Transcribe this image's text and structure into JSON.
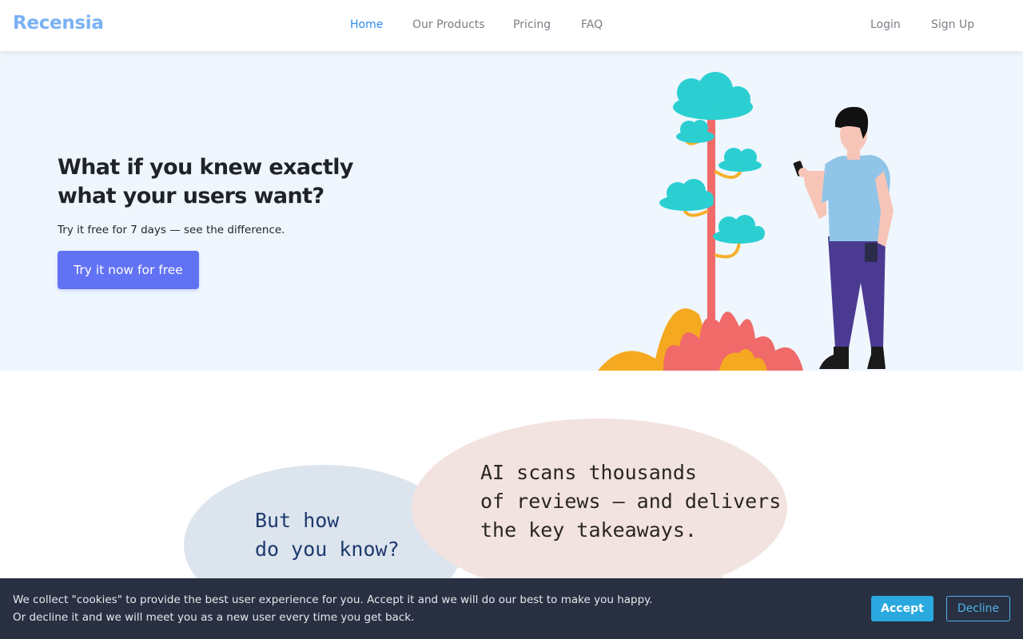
{
  "brand": {
    "name": "Recensia"
  },
  "nav": {
    "items": [
      {
        "label": "Home",
        "active": true
      },
      {
        "label": "Our Products",
        "active": false
      },
      {
        "label": "Pricing",
        "active": false
      },
      {
        "label": "FAQ",
        "active": false
      }
    ],
    "login": "Login",
    "signup": "Sign Up"
  },
  "hero": {
    "title_line1": "What if you knew exactly",
    "title_line2": "what your users want?",
    "subtitle": "Try it free for 7 days — see the difference.",
    "cta_label": "Try it now for free",
    "illustration": "person-with-phone-and-tree"
  },
  "bubbles": {
    "question": "But how\ndo you know?",
    "answer": "AI scans thousands\nof reviews — and delivers\nthe key takeaways."
  },
  "cookie": {
    "line1": "We collect \"cookies\" to provide the best user experience for you. Accept it and we will do our best to make you happy.",
    "line2": "Or decline it and we will meet you as a new user every time you get back.",
    "accept_label": "Accept",
    "decline_label": "Decline"
  },
  "colors": {
    "brand": "#7ab1f5",
    "active_nav": "#2b8ef0",
    "cta": "#6172f4",
    "hero_bg": "#eff6fd",
    "cookie_bg": "#283041",
    "accept": "#2aa9e0"
  }
}
